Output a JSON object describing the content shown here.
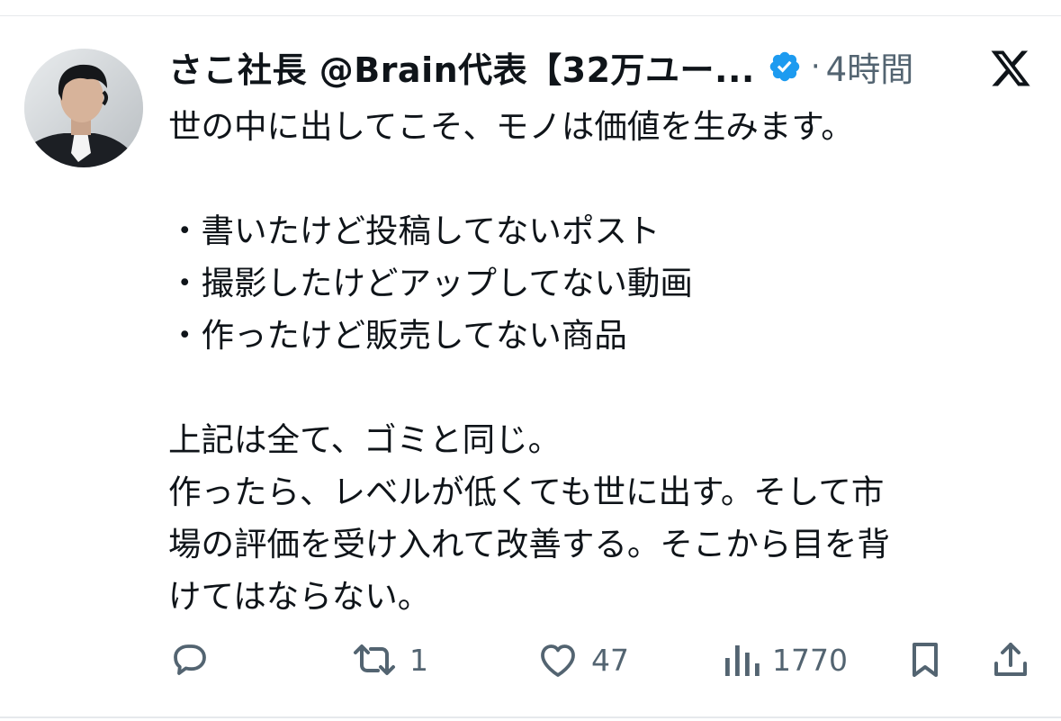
{
  "author": {
    "display_name": "さこ社長 @Brain代表【32万ユー...",
    "verified": true,
    "separator": "·",
    "time_ago": "4時間"
  },
  "post": {
    "lines": [
      "世の中に出してこそ、モノは価値を生みます。",
      "",
      "・書いたけど投稿してないポスト",
      "・撮影したけどアップしてない動画",
      "・作ったけど販売してない商品",
      "",
      "上記は全て、ゴミと同じ。",
      "作ったら、レベルが低くても世に出す。そして市",
      "場の評価を受け入れて改善する。そこから目を背",
      "けてはならない。"
    ]
  },
  "actions": {
    "reply_count": "",
    "repost_count": "1",
    "like_count": "47",
    "views_count": "1770"
  },
  "icons": {
    "reply": "reply-icon",
    "repost": "repost-icon",
    "like": "heart-icon",
    "views": "views-icon",
    "bookmark": "bookmark-icon",
    "share": "share-icon",
    "platform": "x-logo-icon",
    "verified": "verified-badge-icon"
  },
  "colors": {
    "text": "#0f1419",
    "secondary": "#536471",
    "verified": "#1d9bf0"
  }
}
